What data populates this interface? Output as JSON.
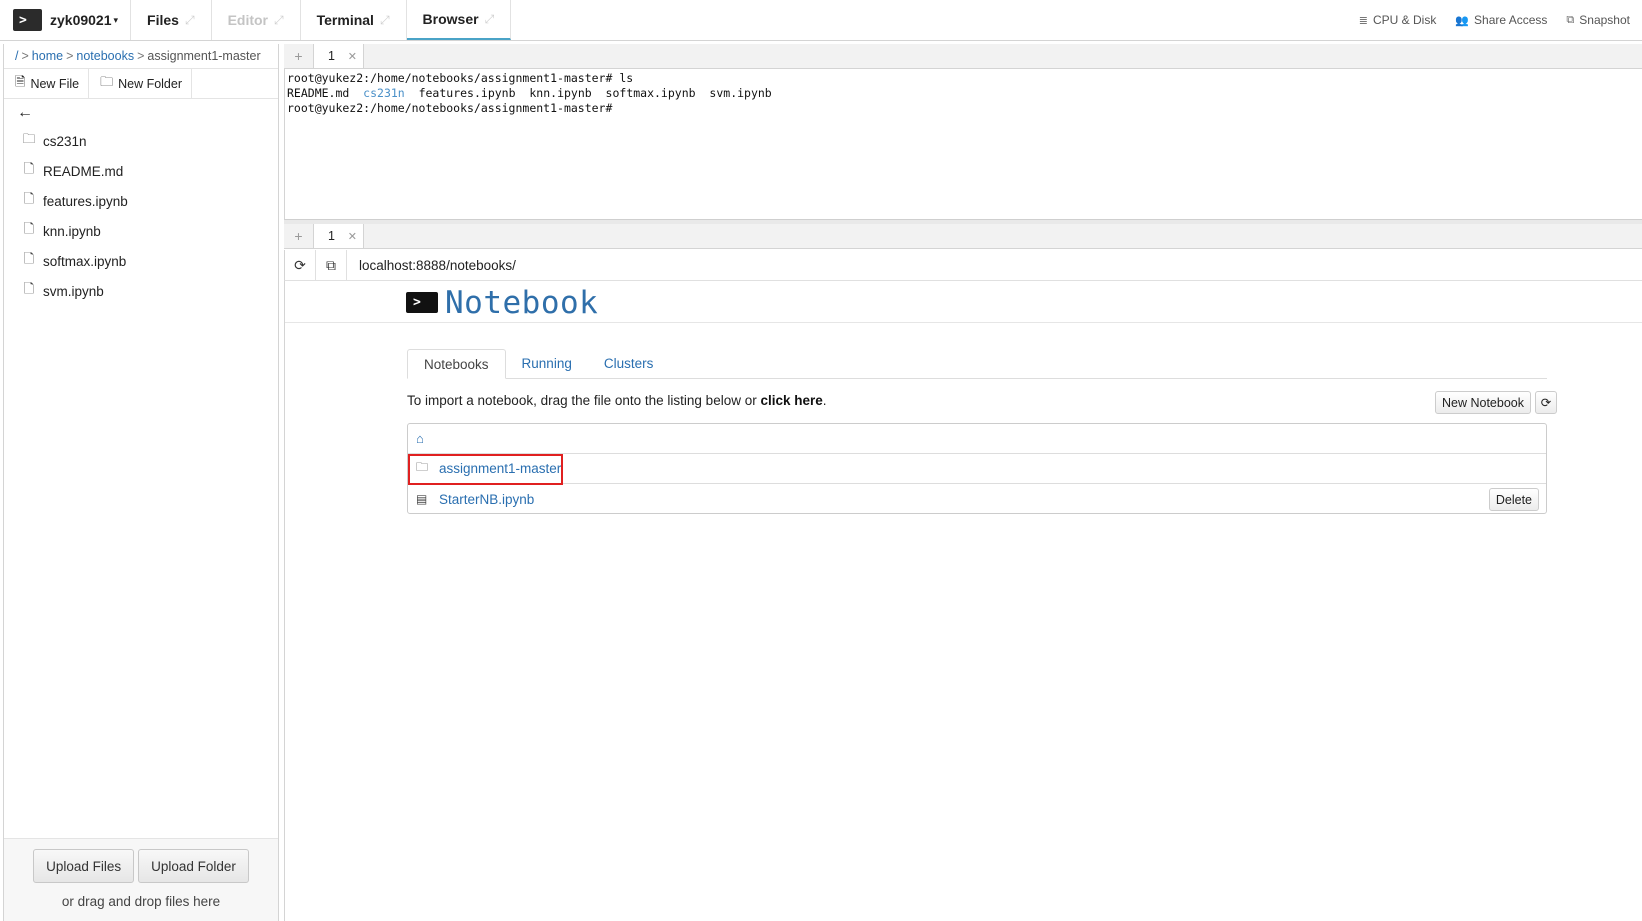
{
  "topbar": {
    "logo_glyph": ">",
    "user": "zyk09021",
    "tabs": [
      {
        "label": "Files"
      },
      {
        "label": "Editor"
      },
      {
        "label": "Terminal"
      },
      {
        "label": "Browser"
      }
    ],
    "actions": [
      {
        "label": "CPU & Disk",
        "icon": "database-icon"
      },
      {
        "label": "Share Access",
        "icon": "users-icon"
      },
      {
        "label": "Snapshot",
        "icon": "snapshot-icon"
      }
    ]
  },
  "filepanel": {
    "breadcrumb": {
      "root": "/",
      "home": "home",
      "notebooks": "notebooks",
      "current": "assignment1-master"
    },
    "new_file_label": "New File",
    "new_folder_label": "New Folder",
    "items": [
      {
        "name": "cs231n",
        "type": "folder"
      },
      {
        "name": "README.md",
        "type": "file"
      },
      {
        "name": "features.ipynb",
        "type": "file"
      },
      {
        "name": "knn.ipynb",
        "type": "file"
      },
      {
        "name": "softmax.ipynb",
        "type": "file"
      },
      {
        "name": "svm.ipynb",
        "type": "file"
      }
    ],
    "upload_files_label": "Upload Files",
    "upload_folder_label": "Upload Folder",
    "drag_text": "or drag and drop files here"
  },
  "terminal": {
    "tab_label": "1",
    "prompt": "root@yukez2:/home/notebooks/assignment1-master#",
    "command": "ls",
    "listing": [
      "README.md",
      "cs231n",
      "features.ipynb",
      "knn.ipynb",
      "softmax.ipynb",
      "svm.ipynb"
    ],
    "dir_color": "#4a90c8"
  },
  "browser": {
    "tab_label": "1",
    "url": "localhost:8888/notebooks/",
    "notebook": {
      "title": "Notebook",
      "tabs": [
        {
          "label": "Notebooks"
        },
        {
          "label": "Running"
        },
        {
          "label": "Clusters"
        }
      ],
      "import_text": "To import a notebook, drag the file onto the listing below or ",
      "import_link": "click here",
      "import_end": ".",
      "new_notebook_label": "New Notebook",
      "rows": [
        {
          "name": "assignment1-master",
          "type": "folder"
        },
        {
          "name": "StarterNB.ipynb",
          "type": "notebook"
        }
      ],
      "delete_label": "Delete",
      "link_color": "#2a6fb0",
      "highlight_color": "#e02020"
    }
  }
}
